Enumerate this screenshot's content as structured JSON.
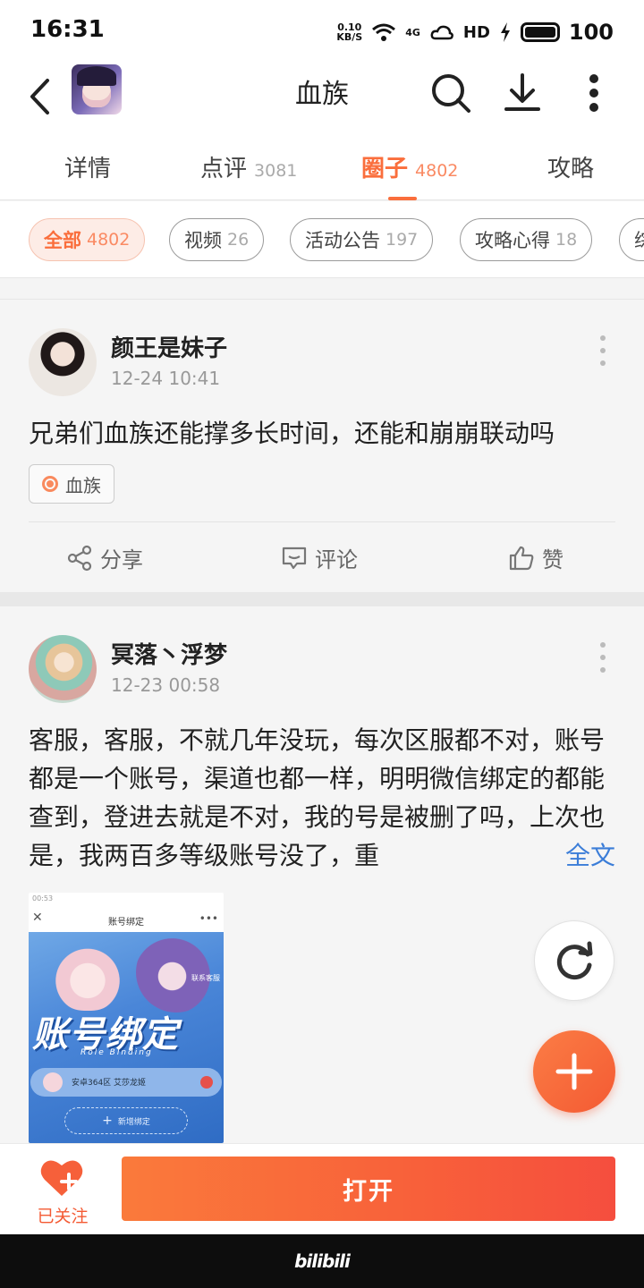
{
  "status_bar": {
    "time": "16:31",
    "net_speed_value": "0.10",
    "net_speed_unit": "KB/S",
    "network": "4G",
    "hd": "HD",
    "battery": "100"
  },
  "header": {
    "title": "血族",
    "icons": [
      "back-icon",
      "search-icon",
      "download-icon",
      "more-vertical-icon"
    ]
  },
  "tabs": [
    {
      "label": "详情",
      "count": ""
    },
    {
      "label": "点评",
      "count": "3081"
    },
    {
      "label": "圈子",
      "count": "4802",
      "active": true
    },
    {
      "label": "攻略",
      "count": ""
    }
  ],
  "filters": [
    {
      "label": "全部",
      "count": "4802",
      "active": true
    },
    {
      "label": "视频",
      "count": "26"
    },
    {
      "label": "活动公告",
      "count": "197"
    },
    {
      "label": "攻略心得",
      "count": "18"
    },
    {
      "label": "综",
      "count": ""
    }
  ],
  "posts": [
    {
      "author": "颜王是妹子",
      "time": "12-24 10:41",
      "text": "兄弟们血族还能撑多长时间，还能和崩崩联动吗",
      "tag": "血族",
      "actions": {
        "share": "分享",
        "comment": "评论",
        "like": "赞"
      }
    },
    {
      "author": "冥落丶浮梦",
      "time": "12-23 00:58",
      "text": "客服，客服，不就几年没玩，每次区服都不对，账号都是一个账号，渠道也都一样，明明微信绑定的都能查到，登进去就是不对，我的号是被删了吗，上次也是，我两百多等级账号没了，重",
      "fulltext": "全文",
      "image": {
        "status": "00:53",
        "title": "账号绑定",
        "banner": "账号绑定",
        "subtitle": "Role Binding",
        "row_text": "安卓364区   艾莎龙姬",
        "add": "新增绑定",
        "contact": "联系客服"
      }
    }
  ],
  "bottom": {
    "follow_label": "已关注",
    "open_label": "打开",
    "brand": "bilibili"
  },
  "colors": {
    "accent": "#fa6e3c",
    "link": "#3b7dd8",
    "fab": "#f45a33"
  }
}
